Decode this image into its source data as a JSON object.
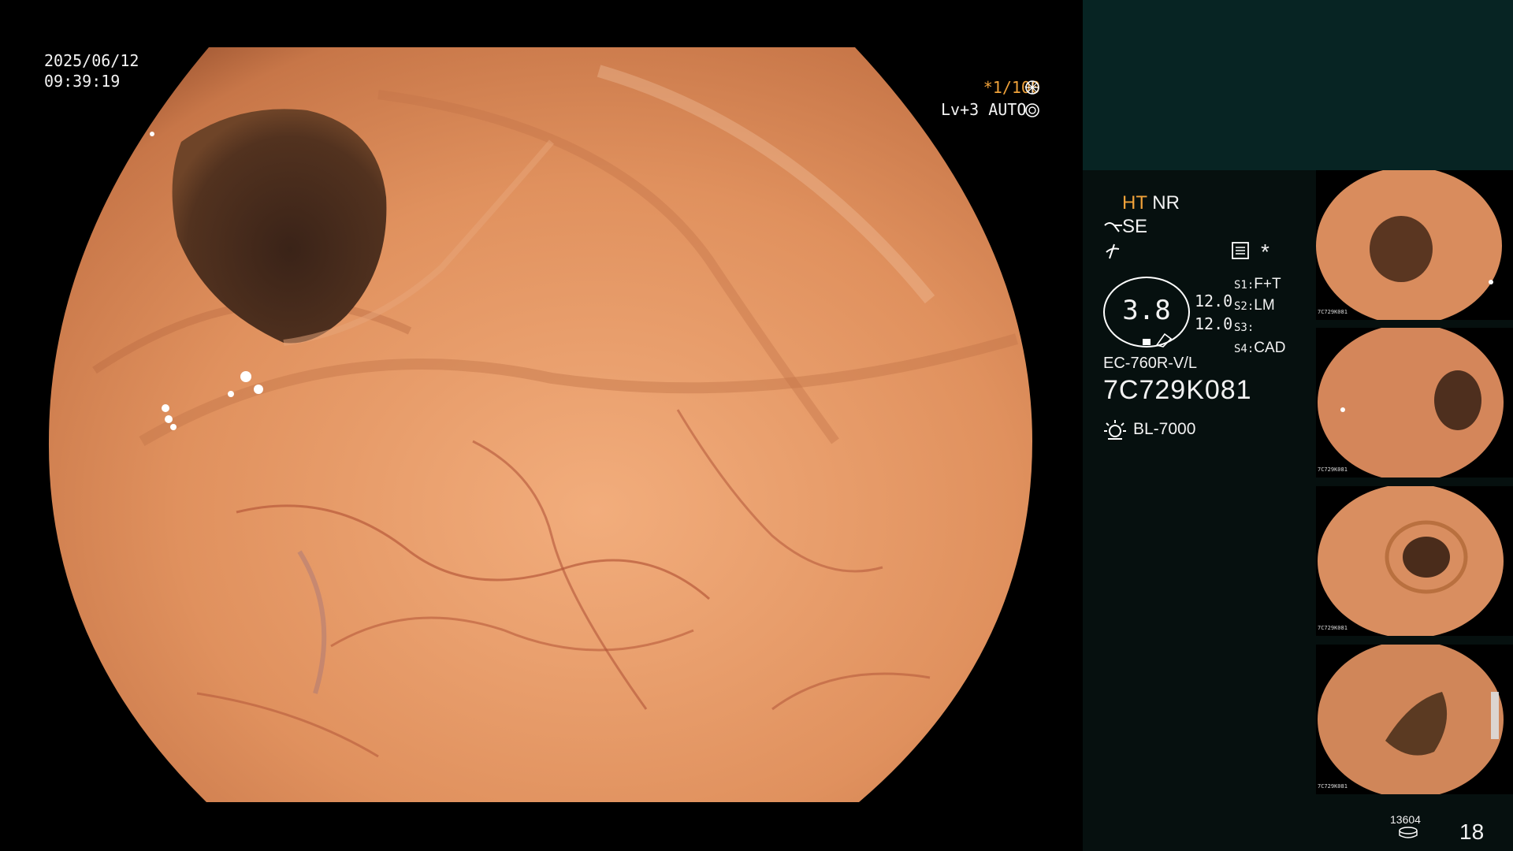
{
  "main": {
    "date": "2025/06/12",
    "time": "09:39:19",
    "shutter": "*1/100",
    "level": "Lv+3",
    "mode": "AUTO",
    "shutter_icon": "aperture-icon",
    "mode_icon": "iris-icon"
  },
  "panel": {
    "ht_label": "HT",
    "nr_label": "NR",
    "se_label": "SE",
    "se_icon": "scope-tip-icon",
    "freeze_icon": "freeze-icon",
    "settings_icon": "list-settings-icon",
    "asterisk": "*",
    "gauge_value": "3.8",
    "value_top": "12.0",
    "value_bottom": "12.0",
    "switches": [
      {
        "key": "S1",
        "value": "F+T"
      },
      {
        "key": "S2",
        "value": "LM"
      },
      {
        "key": "S3",
        "value": ""
      },
      {
        "key": "S4",
        "value": "CAD"
      }
    ],
    "scope_model": "EC-760R-V/L",
    "serial": "7C729K081",
    "light_source": "BL-7000",
    "light_icon": "light-source-icon",
    "counter": "13604",
    "counter_icon": "storage-icon",
    "image_count": "18"
  },
  "thumbnails": [
    {
      "label": "7C729K081"
    },
    {
      "label": "7C729K081"
    },
    {
      "label": "7C729K081"
    },
    {
      "label": "7C729K081"
    }
  ],
  "colors": {
    "accent": "#f0a23a",
    "panel_bg": "#06100f",
    "panel_top": "#072423",
    "tissue": "#e39a6c"
  }
}
